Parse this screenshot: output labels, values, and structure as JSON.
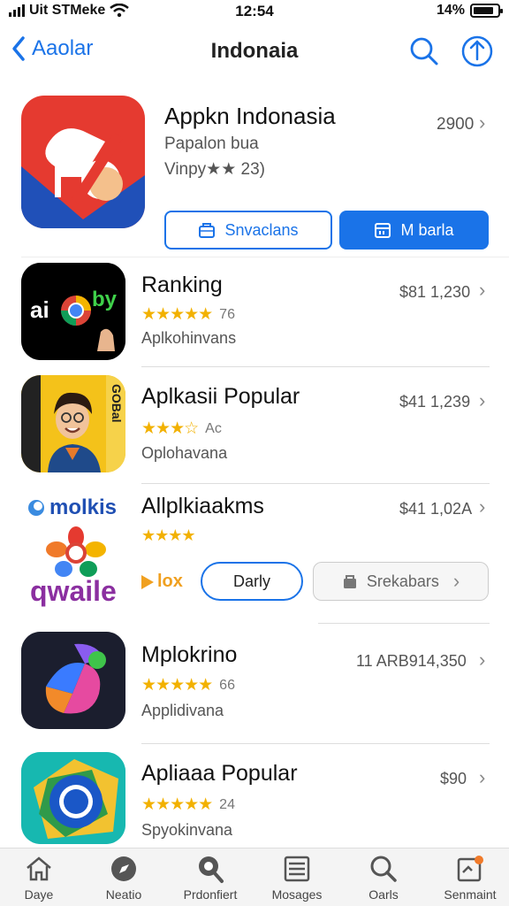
{
  "status_bar": {
    "carrier": "Uit STMeke",
    "time": "12:54",
    "battery": "14%"
  },
  "nav": {
    "back_label": "Aaolar",
    "title": "Indonaia"
  },
  "featured": {
    "title": "Appkn Indonasia",
    "subtitle": "Papalon bua",
    "rating_text": "Vinpy★★ 23)",
    "price": "2900",
    "button_outline": "Snvaclans",
    "button_solid": "M barla"
  },
  "rows": [
    {
      "icon_text": "ai",
      "icon_text2": "by",
      "title": "Ranking",
      "stars": "★★★★★",
      "count": "76",
      "subtitle": "Aplkohinvans",
      "price": "$81 1,230"
    },
    {
      "icon_text": "GOBal",
      "title": "Aplkasii Popular",
      "stars": "★★★☆",
      "count": "Ac",
      "subtitle": "Oplohavana",
      "price": "$41 1,239"
    },
    {
      "icon_text": "molkis",
      "icon_text2": "qwaile",
      "title": "Allplkiaakms",
      "stars": "★★★★",
      "subtitle": "",
      "price": "$41 1,02A",
      "tag": "lox",
      "button_outline": "Darly",
      "button_grey": "Srekabars"
    },
    {
      "title": "Mplokrino",
      "stars": "★★★★★",
      "count": "66",
      "subtitle": "Applidivana",
      "price": "11 ARB914,350"
    },
    {
      "title": "Apliaaa Popular",
      "stars": "★★★★★",
      "count": "24",
      "subtitle": "Spyokinvana",
      "price": "$90"
    }
  ],
  "tabs": [
    {
      "label": "Daye",
      "icon": "home-icon"
    },
    {
      "label": "Neatio",
      "icon": "compass-icon"
    },
    {
      "label": "Prdonfiert",
      "icon": "search-badge-icon"
    },
    {
      "label": "Mosages",
      "icon": "list-icon"
    },
    {
      "label": "Oarls",
      "icon": "search-icon"
    },
    {
      "label": "Senmaint",
      "icon": "note-icon"
    }
  ],
  "colors": {
    "accent": "#1a73e8",
    "star": "#f2b100"
  }
}
